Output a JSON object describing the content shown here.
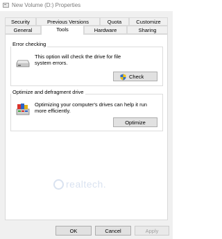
{
  "window": {
    "title": "New Volume (D:) Properties"
  },
  "tabs": {
    "row1": [
      {
        "label": "Security"
      },
      {
        "label": "Previous Versions"
      },
      {
        "label": "Quota"
      },
      {
        "label": "Customize"
      }
    ],
    "row2": [
      {
        "label": "General"
      },
      {
        "label": "Tools"
      },
      {
        "label": "Hardware"
      },
      {
        "label": "Sharing"
      }
    ],
    "selected": "Tools"
  },
  "error_checking": {
    "group_title": "Error checking",
    "description": "This option will check the drive for file system errors.",
    "button_label": "Check"
  },
  "optimize": {
    "group_title": "Optimize and defragment drive",
    "description": "Optimizing your computer's drives can help it run more efficiently.",
    "button_label": "Optimize"
  },
  "watermark": {
    "text": "realtech."
  },
  "footer": {
    "ok_label": "OK",
    "cancel_label": "Cancel",
    "apply_label": "Apply"
  },
  "colors": {
    "dialog_background": "#f0f0f0",
    "panel_background": "#ffffff",
    "title_text": "#7a7a7a",
    "button_face": "#e1e1e1",
    "disabled_text": "#a0a0a0"
  }
}
